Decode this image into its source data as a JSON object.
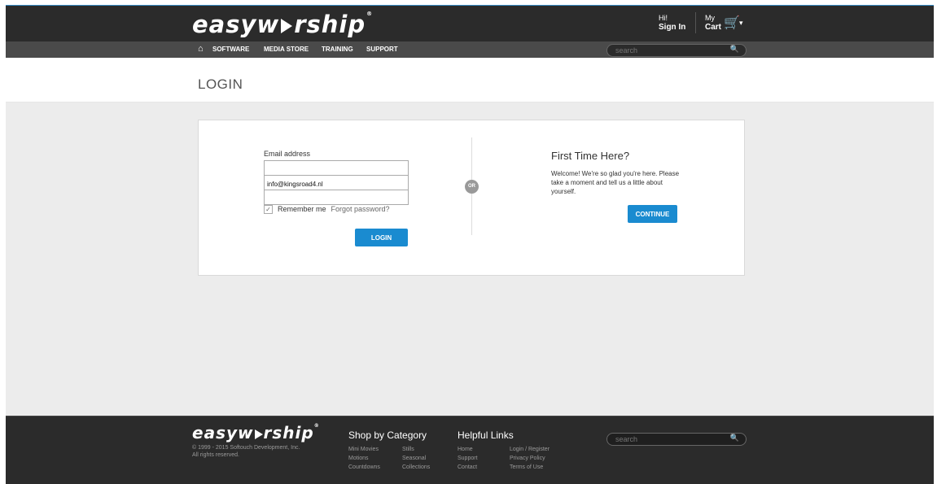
{
  "header": {
    "logo_text": "easyworship",
    "user_greeting": "Hi!",
    "user_action": "Sign In",
    "cart_line1": "My",
    "cart_line2": "Cart",
    "nav": [
      "SOFTWARE",
      "MEDIA STORE",
      "TRAINING",
      "SUPPORT"
    ],
    "search_placeholder": "search"
  },
  "page": {
    "title": "LOGIN"
  },
  "login": {
    "email_label": "Email address",
    "email_value": "",
    "autofill_email": "info@kingsroad4.nl",
    "password_value": "",
    "remember_label": "Remember me",
    "forgot_label": "Forgot password?",
    "login_button": "LOGIN",
    "or_label": "OR"
  },
  "first_time": {
    "title": "First Time Here?",
    "text": "Welcome! We're so glad you're here. Please take a moment and tell us a little about yourself.",
    "continue_button": "CONTINUE"
  },
  "footer": {
    "logo_text": "easyworship",
    "copyright_line1": "© 1999 - 2015 Softouch Development, Inc.",
    "copyright_line2": "All rights reserved.",
    "shop_title": "Shop by Category",
    "shop_col1": [
      "Mini Movies",
      "Motions",
      "Countdowns"
    ],
    "shop_col2": [
      "Stills",
      "Seasonal",
      "Collections"
    ],
    "help_title": "Helpful Links",
    "help_col1": [
      "Home",
      "Support",
      "Contact"
    ],
    "help_col2": [
      "Login / Register",
      "Privacy Policy",
      "Terms of Use"
    ],
    "search_placeholder": "search"
  },
  "colors": {
    "accent": "#1a8bd0",
    "header_bg": "#2b2b2b",
    "nav_bg": "#4a4a4a",
    "body_bg": "#ececec"
  }
}
